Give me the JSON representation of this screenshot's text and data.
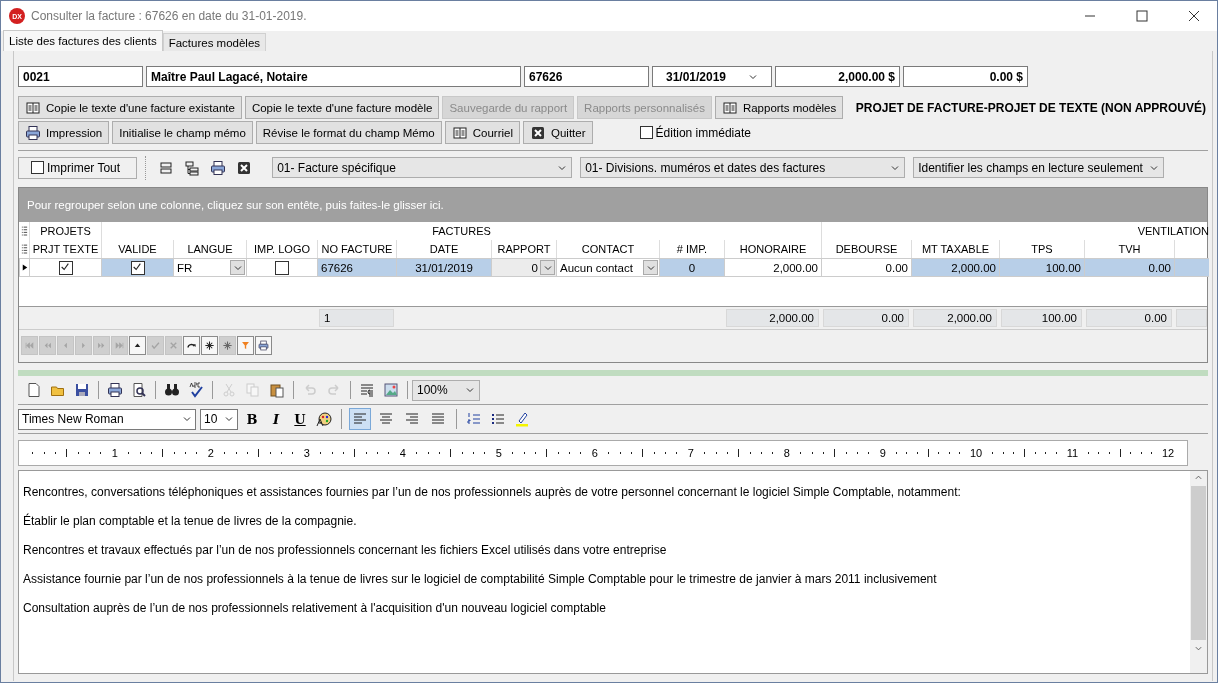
{
  "window": {
    "logo_text": "DX",
    "title": "Consulter la facture : 67626 en date du 31-01-2019."
  },
  "tabs": [
    {
      "label": "Liste des factures des clients",
      "selected": true
    },
    {
      "label": "Factures modèles",
      "selected": false
    }
  ],
  "header_fields": [
    {
      "kind": "code",
      "value": "0021"
    },
    {
      "kind": "name",
      "value": "Maître Paul Lagacé, Notaire"
    },
    {
      "kind": "code",
      "value": "67626"
    },
    {
      "kind": "date",
      "value": "31/01/2019"
    },
    {
      "kind": "amount",
      "value": "2,000.00 $"
    },
    {
      "kind": "amount",
      "value": "0.00 $"
    }
  ],
  "actions_row1": [
    {
      "label": "Copie le texte d'une facture existante",
      "kind": "book",
      "disabled": false
    },
    {
      "label": "Copie le texte d'une facture modèle",
      "kind": "plain",
      "disabled": false
    },
    {
      "label": "Sauvegarde du rapport",
      "kind": "plain",
      "disabled": true
    },
    {
      "label": "Rapports personnalisés",
      "kind": "plain",
      "disabled": true
    },
    {
      "label": "Rapports modèles",
      "kind": "book",
      "disabled": false
    }
  ],
  "status_heading": "PROJET DE FACTURE-PROJET DE TEXTE (NON APPROUVÉ)",
  "actions_row2": [
    {
      "label": "Impression",
      "kind": "printer",
      "disabled": false
    },
    {
      "label": "Initialise le champ mémo",
      "kind": "plain",
      "disabled": false
    },
    {
      "label": "Révise le format du champ Mémo",
      "kind": "plain",
      "disabled": false
    },
    {
      "label": "Courriel",
      "kind": "book",
      "disabled": false
    },
    {
      "label": "Quitter",
      "kind": "close",
      "disabled": false
    }
  ],
  "immediate_edit": {
    "label": "Édition immédiate",
    "checked": false
  },
  "print_all": {
    "label": "Imprimer Tout",
    "checked": false
  },
  "grid_tools": [
    {
      "kind": "rows"
    },
    {
      "kind": "tree"
    },
    {
      "kind": "printer"
    },
    {
      "kind": "close"
    }
  ],
  "selectors": [
    {
      "value": "01- Facture spécifique"
    },
    {
      "value": "01- Divisions. muméros et dates des factures"
    },
    {
      "value": "Identifier les champs en lecture seulement"
    }
  ],
  "grid": {
    "group_hint": "Pour regrouper selon une colonne, cliquez sur son entête, puis faites-le glisser ici.",
    "bands": [
      {
        "label": "PROJETS"
      },
      {
        "label": "FACTURES"
      },
      {
        "label": "VENTILATION"
      }
    ],
    "columns": [
      {
        "label": "PRJT TEXTE"
      },
      {
        "label": "VALIDE"
      },
      {
        "label": "LANGUE"
      },
      {
        "label": "IMP. LOGO"
      },
      {
        "label": "NO FACTURE"
      },
      {
        "label": "DATE"
      },
      {
        "label": "RAPPORT"
      },
      {
        "label": "CONTACT"
      },
      {
        "label": "# IMP."
      },
      {
        "label": "HONORAIRE"
      },
      {
        "label": "DEBOURSE"
      },
      {
        "label": "MT TAXABLE"
      },
      {
        "label": "TPS"
      },
      {
        "label": "TVH"
      },
      {}
    ],
    "rows": [
      {
        "current": true,
        "cells": [
          {
            "kind": "check",
            "checked": true,
            "selected": false
          },
          {
            "kind": "check",
            "checked": true,
            "selected": true
          },
          {
            "kind": "select",
            "value": "FR",
            "selected": false
          },
          {
            "kind": "check",
            "checked": false,
            "selected": false
          },
          {
            "kind": "text",
            "value": "67626",
            "selected": true
          },
          {
            "kind": "date",
            "value": "31/01/2019",
            "selected": true
          },
          {
            "kind": "select",
            "value": "0",
            "selected": false
          },
          {
            "kind": "select",
            "value": "Aucun contact",
            "selected": false
          },
          {
            "kind": "count",
            "value": "0",
            "selected": true
          },
          {
            "kind": "number",
            "value": "2,000.00",
            "selected": false
          },
          {
            "kind": "number",
            "value": "0.00",
            "selected": false
          },
          {
            "kind": "number",
            "value": "2,000.00",
            "selected": true
          },
          {
            "kind": "number",
            "value": "100.00",
            "selected": true
          },
          {
            "kind": "number",
            "value": "0.00",
            "selected": true
          },
          {
            "kind": "number",
            "selected": true
          }
        ]
      }
    ],
    "footer": [
      {
        "kind": "none"
      },
      {
        "kind": "none"
      },
      {
        "kind": "none"
      },
      {
        "kind": "none"
      },
      {
        "kind": "total",
        "value": "1"
      },
      {
        "kind": "none"
      },
      {
        "kind": "none"
      },
      {
        "kind": "none"
      },
      {
        "kind": "none"
      },
      {
        "kind": "total",
        "value": "2,000.00"
      },
      {
        "kind": "total",
        "value": "0.00"
      },
      {
        "kind": "total",
        "value": "2,000.00"
      },
      {
        "kind": "total",
        "value": "100.00"
      },
      {
        "kind": "total",
        "value": "0.00"
      },
      {
        "kind": "blank"
      }
    ],
    "navigator": [
      {
        "kind": "first",
        "disabled": true
      },
      {
        "kind": "prev-page",
        "disabled": true
      },
      {
        "kind": "prev",
        "disabled": true
      },
      {
        "kind": "next",
        "disabled": true
      },
      {
        "kind": "next-page",
        "disabled": true
      },
      {
        "kind": "last",
        "disabled": true
      },
      {
        "kind": "up",
        "disabled": false
      },
      {
        "kind": "check",
        "disabled": true
      },
      {
        "kind": "cancel",
        "disabled": true
      },
      {
        "kind": "refresh",
        "disabled": false
      },
      {
        "kind": "star",
        "disabled": false
      },
      {
        "kind": "star",
        "disabled": true
      },
      {
        "kind": "filter",
        "disabled": false
      },
      {
        "kind": "printer",
        "disabled": false
      }
    ]
  },
  "editor_tools": [
    [
      {
        "kind": "new",
        "disabled": false
      },
      {
        "kind": "open",
        "disabled": false
      },
      {
        "kind": "save",
        "disabled": false
      }
    ],
    [
      {
        "kind": "printer",
        "disabled": false
      },
      {
        "kind": "preview",
        "disabled": false
      }
    ],
    [
      {
        "kind": "find",
        "disabled": false
      },
      {
        "kind": "spell",
        "disabled": false
      }
    ],
    [
      {
        "kind": "cut",
        "disabled": true
      },
      {
        "kind": "copy",
        "disabled": true
      },
      {
        "kind": "paste",
        "disabled": false
      }
    ],
    [
      {
        "kind": "undo",
        "disabled": true
      },
      {
        "kind": "redo",
        "disabled": true
      }
    ],
    [
      {
        "kind": "paragraph",
        "disabled": false
      },
      {
        "kind": "image",
        "disabled": false
      }
    ]
  ],
  "zoom": {
    "value": "100%"
  },
  "font": {
    "value": "Times New Roman"
  },
  "font_size": {
    "value": "10"
  },
  "styles": [
    {
      "kind": "bold",
      "label": "B"
    },
    {
      "kind": "italic",
      "label": "I"
    },
    {
      "kind": "underline",
      "label": "U"
    },
    {
      "kind": "palette"
    }
  ],
  "alignment": [
    {
      "kind": "left",
      "selected": true
    },
    {
      "kind": "center",
      "selected": false
    },
    {
      "kind": "right",
      "selected": false
    },
    {
      "kind": "justify",
      "selected": false
    }
  ],
  "lists": [
    {
      "kind": "numbered"
    },
    {
      "kind": "bulleted"
    },
    {
      "kind": "highlight"
    }
  ],
  "ruler": {
    "labels": [
      "1",
      "2",
      "3",
      "4",
      "5",
      "6",
      "7",
      "8",
      "9",
      "10",
      "11",
      "12"
    ]
  },
  "paragraphs": [
    "Rencontres, conversations téléphoniques et assistances fournies par l’un de nos professionnels auprès de votre personnel concernant le logiciel Simple Comptable, notamment:",
    "Établir le plan comptable et la tenue de livres de la compagnie.",
    "Rencontres et travaux effectués par l’un de nos professionnels concernant les fichiers Excel utilisés dans votre entreprise",
    "Assistance fournie par l’un de nos professionnels à la tenue de livres sur le logiciel de comptabilité Simple Comptable pour le trimestre de janvier à mars 2011 inclusivement",
    "Consultation auprès de l’un de nos professionnels relativement à l'acquisition d'un nouveau logiciel comptable"
  ]
}
